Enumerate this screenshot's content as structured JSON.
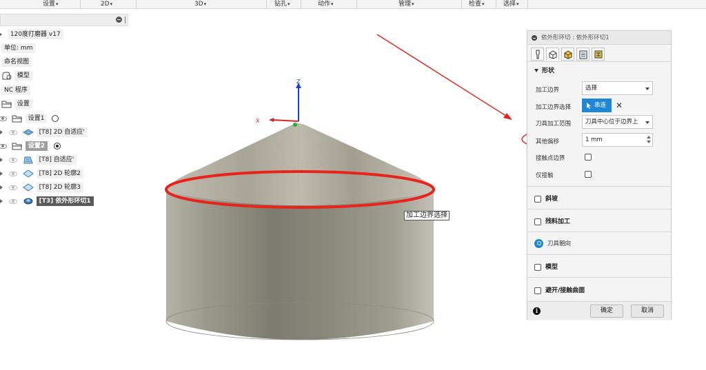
{
  "menubar": {
    "items": [
      {
        "label": "设置"
      },
      {
        "label": "2D"
      },
      {
        "label": "3D"
      },
      {
        "label": "钻孔"
      },
      {
        "label": "动作"
      },
      {
        "label": "管理"
      },
      {
        "label": "检查"
      },
      {
        "label": "选择"
      }
    ],
    "caret": "▾"
  },
  "browser": {
    "root": "120度打磨器 v17",
    "units": "单位: mm",
    "named_views": "命名视图",
    "model": "模型",
    "nc_programs": "NC 程序",
    "setups": "设置",
    "setup1": {
      "label": "设置1",
      "op1": "[T8] 2D 自适应'"
    },
    "setup2": {
      "label": "设置2",
      "ops": [
        "[T8] 自适应'",
        "[T8] 2D 轮廓2",
        "[T8] 2D 轮廓3",
        "[T3] 依外形环切1"
      ]
    }
  },
  "viewport": {
    "axis_z": "Z",
    "axis_x": "X",
    "tooltip": "加工边界选择"
  },
  "dialog": {
    "title": "依外形环切 : 依外形环切1",
    "section_shape": "形状",
    "machining_boundary_label": "加工边界",
    "machining_boundary_value": "选择",
    "boundary_selection_label": "加工边界选择",
    "boundary_selection_value": "串连",
    "tool_containment_label": "刀具加工范围",
    "tool_containment_value": "刀具中心位于边界上",
    "additional_offset_label": "其他偏移",
    "additional_offset_value": "1 mm",
    "contact_point_boundary_label": "接触点边界",
    "contact_only_label": "仅接触",
    "slope_label": "斜坡",
    "rest_machining_label": "残料加工",
    "tool_orientation_label": "刀具朝向",
    "model_label": "模型",
    "avoid_touch_label": "避开/接触曲面",
    "ok_label": "确定",
    "cancel_label": "取消",
    "info_glyph": "i"
  },
  "colors": {
    "accent": "#1e88d6",
    "annotation": "#e8231c",
    "cone_body": "#9c9a8c"
  }
}
